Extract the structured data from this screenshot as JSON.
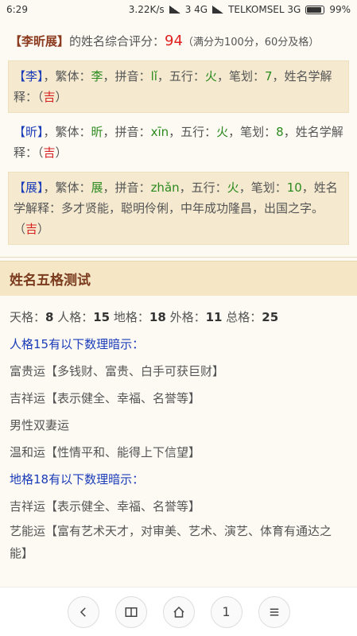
{
  "status": {
    "time": "6:29",
    "speed": "3.22K/s",
    "net1": "3 4G",
    "carrier": "TELKOMSEL 3G",
    "battery": "99%"
  },
  "summary": {
    "name": "【李昕展】",
    "text": "的姓名综合评分：",
    "score": "94",
    "note": "（满分为100分，60分及格）"
  },
  "chars": [
    {
      "char": "【李】",
      "label1": "，繁体：",
      "trad": "李",
      "label2": "，拼音：",
      "pinyin": "lǐ",
      "label3": "，五行：",
      "wuxing": "火",
      "label4": "，笔划：",
      "strokes": "7",
      "label5": "，姓名学解释：（",
      "meaning": "吉",
      "end": "）"
    },
    {
      "char": "【昕】",
      "label1": "，繁体：",
      "trad": "昕",
      "label2": "，拼音：",
      "pinyin": "xīn",
      "label3": "，五行：",
      "wuxing": "火",
      "label4": "，笔划：",
      "strokes": "8",
      "label5": "，姓名学解释：（",
      "meaning": "吉",
      "end": "）"
    },
    {
      "char": "【展】",
      "label1": "，繁体：",
      "trad": "展",
      "label2": "，拼音：",
      "pinyin": "zhǎn",
      "label3": "，五行：",
      "wuxing": "火",
      "label4": "，笔划：",
      "strokes": "10",
      "label5": "，姓名学解释：多才贤能，聪明伶俐，中年成功隆昌，出国之字。（",
      "meaning": "吉",
      "end": "）"
    }
  ],
  "section": {
    "title": "姓名五格测试"
  },
  "wuge": {
    "tian_label": "天格：",
    "tian": "8",
    "ren_label": "人格：",
    "ren": "15",
    "di_label": "地格：",
    "di": "18",
    "wai_label": "外格：",
    "wai": "11",
    "zong_label": "总格：",
    "zong": "25",
    "ren_hint": "人格15有以下数理暗示：",
    "ren_items": [
      "富贵运【多钱财、富贵、白手可获巨财】",
      "吉祥运【表示健全、幸福、名誉等】",
      "男性双妻运",
      "温和运【性情平和、能得上下信望】"
    ],
    "di_hint": "地格18有以下数理暗示：",
    "di_items": [
      "吉祥运【表示健全、幸福、名誉等】",
      "艺能运【富有艺术天才，对审美、艺术、演艺、体育有通达之能】"
    ]
  },
  "bottom": {
    "page": "1"
  },
  "icons": [
    "back-icon",
    "book-icon",
    "home-icon",
    "menu-icon"
  ]
}
